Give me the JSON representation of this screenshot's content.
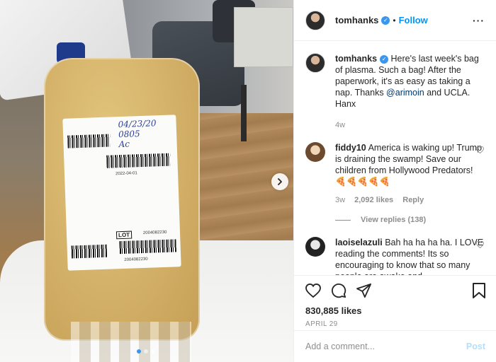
{
  "photo": {
    "label_handwriting": [
      "04/23/20",
      "0805",
      "Ac"
    ],
    "label_codes": [
      "2022-04-01",
      "2004082230",
      "2004082230"
    ],
    "label_lot": "LOT"
  },
  "header": {
    "username": "tomhanks",
    "follow_label": "Follow",
    "more_label": "···"
  },
  "caption": {
    "username": "tomhanks",
    "text_before": "Here's last week's bag of plasma. Such a bag!  After the paperwork, it's as easy as taking a nap.  Thanks ",
    "mention": "@arimoin",
    "text_after": " and UCLA. Hanx",
    "age": "4w"
  },
  "comments": [
    {
      "username": "fiddy10",
      "text": "America is waking up! Trump is draining the swamp! Save our children from Hollywood Predators! 🍕🍕🍕🍕🍕",
      "age": "3w",
      "likes": "2,092 likes",
      "reply": "Reply",
      "view_replies": "View replies (138)"
    },
    {
      "username": "laoiselazuli",
      "text": "Bah ha ha ha ha. I LOVE reading the comments! Its so encouraging to know that so many people are awake and"
    }
  ],
  "actions": {
    "likes": "830,885 likes",
    "date": "APRIL 29"
  },
  "add_comment": {
    "placeholder": "Add a comment...",
    "post_label": "Post"
  },
  "icons": [
    "verified-icon",
    "more-icon",
    "heart-icon",
    "comment-icon",
    "share-icon",
    "bookmark-icon",
    "chevron-right-icon"
  ],
  "colors": {
    "link": "#0095f6",
    "verified": "#3897f0",
    "post_disabled": "#b2dffc"
  }
}
